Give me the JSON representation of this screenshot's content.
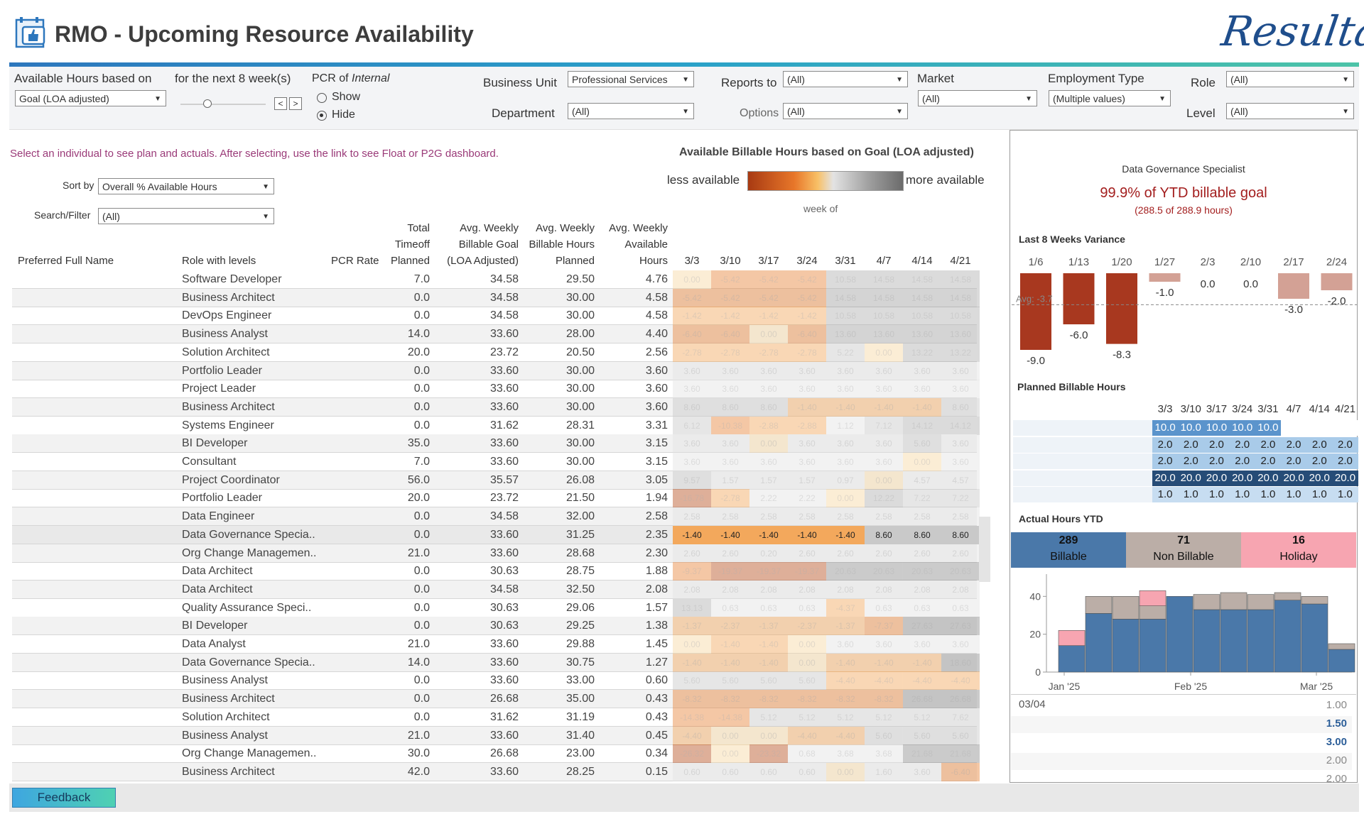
{
  "header": {
    "title": "RMO - Upcoming Resource Availability",
    "logo_text": "Resultant"
  },
  "filters": {
    "available_hours_label": "Available Hours based on",
    "available_hours_value": "Goal (LOA adjusted)",
    "next_weeks_label": "for the next 8 week(s)",
    "pcr_label": "PCR of",
    "pcr_label_italic": "Internal",
    "pcr_show": "Show",
    "pcr_hide": "Hide",
    "pcr_selected": "Hide",
    "business_unit_label": "Business Unit",
    "business_unit_value": "Professional Services",
    "department_label": "Department",
    "department_value": "(All)",
    "reports_to_label": "Reports to",
    "reports_to_value": "(All)",
    "options_label": "Options",
    "options_value": "(All)",
    "market_label": "Market",
    "market_value": "(All)",
    "employment_type_label": "Employment Type",
    "employment_type_value": "(Multiple values)",
    "role_label": "Role",
    "role_value": "(All)",
    "level_label": "Level",
    "level_value": "(All)"
  },
  "main": {
    "instruction": "Select an individual to see plan and actuals.  After selecting, use the link to see Float or P2G dashboard.",
    "sort_by_label": "Sort by",
    "sort_by_value": "Overall % Available Hours",
    "search_label": "Search/Filter",
    "search_value": "(All)",
    "legend_title": "Available Billable Hours based on Goal (LOA adjusted)",
    "legend_less": "less available",
    "legend_more": "more available",
    "week_of_label": "week of"
  },
  "table": {
    "columns": {
      "name": "Preferred Full Name",
      "role": "Role with levels",
      "pcr": "PCR Rate",
      "timeoff": [
        "Total",
        "Timeoff",
        "Planned"
      ],
      "goal": [
        "Avg. Weekly",
        "Billable Goal",
        "(LOA Adjusted)"
      ],
      "planned": [
        "Avg. Weekly",
        "Billable Hours",
        "Planned"
      ],
      "available": [
        "Avg. Weekly",
        "Available",
        "Hours"
      ]
    },
    "weeks": [
      "3/3",
      "3/10",
      "3/17",
      "3/24",
      "3/31",
      "4/7",
      "4/14",
      "4/21"
    ],
    "rows": [
      {
        "role": "Software Developer",
        "timeoff": "7.0",
        "goal": "34.58",
        "planned": "29.50",
        "available": "4.76",
        "weeks": [
          "0.00",
          "-5.42",
          "-5.42",
          "-5.42",
          "10.58",
          "14.58",
          "14.58",
          "14.58"
        ]
      },
      {
        "role": "Business Architect",
        "timeoff": "0.0",
        "goal": "34.58",
        "planned": "30.00",
        "available": "4.58",
        "weeks": [
          "-5.42",
          "-5.42",
          "-5.42",
          "-5.42",
          "14.58",
          "14.58",
          "14.58",
          "14.58"
        ]
      },
      {
        "role": "DevOps Engineer",
        "timeoff": "0.0",
        "goal": "34.58",
        "planned": "30.00",
        "available": "4.58",
        "weeks": [
          "-1.42",
          "-1.42",
          "-1.42",
          "-1.42",
          "10.58",
          "10.58",
          "10.58",
          "10.58"
        ]
      },
      {
        "role": "Business Analyst",
        "timeoff": "14.0",
        "goal": "33.60",
        "planned": "28.00",
        "available": "4.40",
        "weeks": [
          "-6.40",
          "-6.40",
          "0.00",
          "-6.40",
          "13.60",
          "13.60",
          "13.60",
          "13.60"
        ]
      },
      {
        "role": "Solution Architect",
        "timeoff": "20.0",
        "goal": "23.72",
        "planned": "20.50",
        "available": "2.56",
        "weeks": [
          "-2.78",
          "-2.78",
          "-2.78",
          "-2.78",
          "5.22",
          "0.00",
          "13.22",
          "13.22"
        ]
      },
      {
        "role": "Portfolio Leader",
        "timeoff": "0.0",
        "goal": "33.60",
        "planned": "30.00",
        "available": "3.60",
        "weeks": [
          "3.60",
          "3.60",
          "3.60",
          "3.60",
          "3.60",
          "3.60",
          "3.60",
          "3.60"
        ]
      },
      {
        "role": "Project Leader",
        "timeoff": "0.0",
        "goal": "33.60",
        "planned": "30.00",
        "available": "3.60",
        "weeks": [
          "3.60",
          "3.60",
          "3.60",
          "3.60",
          "3.60",
          "3.60",
          "3.60",
          "3.60"
        ]
      },
      {
        "role": "Business Architect",
        "timeoff": "0.0",
        "goal": "33.60",
        "planned": "30.00",
        "available": "3.60",
        "weeks": [
          "8.60",
          "8.60",
          "8.60",
          "-1.40",
          "-1.40",
          "-1.40",
          "-1.40",
          "8.60"
        ]
      },
      {
        "role": "Systems Engineer",
        "timeoff": "0.0",
        "goal": "31.62",
        "planned": "28.31",
        "available": "3.31",
        "weeks": [
          "6.12",
          "-10.38",
          "-2.88",
          "-2.88",
          "1.12",
          "7.12",
          "14.12",
          "14.12"
        ]
      },
      {
        "role": "BI Developer",
        "timeoff": "35.0",
        "goal": "33.60",
        "planned": "30.00",
        "available": "3.15",
        "weeks": [
          "3.60",
          "3.60",
          "0.00",
          "3.60",
          "3.60",
          "3.60",
          "5.60",
          "3.60"
        ]
      },
      {
        "role": "Consultant",
        "timeoff": "7.0",
        "goal": "33.60",
        "planned": "30.00",
        "available": "3.15",
        "weeks": [
          "3.60",
          "3.60",
          "3.60",
          "3.60",
          "3.60",
          "3.60",
          "0.00",
          "3.60"
        ]
      },
      {
        "role": "Project Coordinator",
        "timeoff": "56.0",
        "goal": "35.57",
        "planned": "26.08",
        "available": "3.05",
        "weeks": [
          "9.57",
          "1.57",
          "1.57",
          "1.57",
          "0.97",
          "0.00",
          "4.57",
          "4.57"
        ]
      },
      {
        "role": "Portfolio Leader",
        "timeoff": "20.0",
        "goal": "23.72",
        "planned": "21.50",
        "available": "1.94",
        "weeks": [
          "-16.78",
          "-2.78",
          "2.22",
          "2.22",
          "0.00",
          "12.22",
          "7.22",
          "7.22"
        ]
      },
      {
        "role": "Data Engineer",
        "timeoff": "0.0",
        "goal": "34.58",
        "planned": "32.00",
        "available": "2.58",
        "weeks": [
          "2.58",
          "2.58",
          "2.58",
          "2.58",
          "2.58",
          "2.58",
          "2.58",
          "2.58"
        ]
      },
      {
        "role": "Data Governance Specia..",
        "timeoff": "0.0",
        "goal": "33.60",
        "planned": "31.25",
        "available": "2.35",
        "weeks": [
          "-1.40",
          "-1.40",
          "-1.40",
          "-1.40",
          "-1.40",
          "8.60",
          "8.60",
          "8.60"
        ],
        "selected": true
      },
      {
        "role": "Org Change Managemen..",
        "timeoff": "21.0",
        "goal": "33.60",
        "planned": "28.68",
        "available": "2.30",
        "weeks": [
          "2.60",
          "2.60",
          "0.20",
          "2.60",
          "2.60",
          "2.60",
          "2.60",
          "2.60"
        ]
      },
      {
        "role": "Data Architect",
        "timeoff": "0.0",
        "goal": "30.63",
        "planned": "28.75",
        "available": "1.88",
        "weeks": [
          "-9.37",
          "-19.37",
          "-19.37",
          "-19.37",
          "20.63",
          "20.63",
          "20.63",
          "20.63"
        ]
      },
      {
        "role": "Data Architect",
        "timeoff": "0.0",
        "goal": "34.58",
        "planned": "32.50",
        "available": "2.08",
        "weeks": [
          "2.08",
          "2.08",
          "2.08",
          "2.08",
          "2.08",
          "2.08",
          "2.08",
          "2.08"
        ]
      },
      {
        "role": "Quality Assurance Speci..",
        "timeoff": "0.0",
        "goal": "30.63",
        "planned": "29.06",
        "available": "1.57",
        "weeks": [
          "13.13",
          "0.63",
          "0.63",
          "0.63",
          "-4.37",
          "0.63",
          "0.63",
          "0.63"
        ]
      },
      {
        "role": "BI Developer",
        "timeoff": "0.0",
        "goal": "30.63",
        "planned": "29.25",
        "available": "1.38",
        "weeks": [
          "-1.37",
          "-2.37",
          "-1.37",
          "-2.37",
          "-1.37",
          "-7.37",
          "27.63",
          "27.63"
        ]
      },
      {
        "role": "Data Analyst",
        "timeoff": "21.0",
        "goal": "33.60",
        "planned": "29.88",
        "available": "1.45",
        "weeks": [
          "0.00",
          "-1.40",
          "-1.40",
          "0.00",
          "3.60",
          "3.60",
          "3.60",
          "3.60"
        ]
      },
      {
        "role": "Data Governance Specia..",
        "timeoff": "14.0",
        "goal": "33.60",
        "planned": "30.75",
        "available": "1.27",
        "weeks": [
          "-1.40",
          "-1.40",
          "-1.40",
          "0.00",
          "-1.40",
          "-1.40",
          "-1.40",
          "18.60"
        ]
      },
      {
        "role": "Business Analyst",
        "timeoff": "0.0",
        "goal": "33.60",
        "planned": "33.00",
        "available": "0.60",
        "weeks": [
          "5.60",
          "5.60",
          "5.60",
          "5.60",
          "-4.40",
          "-4.40",
          "-4.40",
          "-4.40"
        ]
      },
      {
        "role": "Business Architect",
        "timeoff": "0.0",
        "goal": "26.68",
        "planned": "35.00",
        "available": "0.43",
        "weeks": [
          "-8.32",
          "-8.32",
          "-8.32",
          "-8.32",
          "-8.32",
          "-8.32",
          "26.68",
          "26.68"
        ]
      },
      {
        "role": "Solution Architect",
        "timeoff": "0.0",
        "goal": "31.62",
        "planned": "31.19",
        "available": "0.43",
        "weeks": [
          "-14.38",
          "-14.38",
          "5.12",
          "5.12",
          "5.12",
          "5.12",
          "5.12",
          "7.62"
        ]
      },
      {
        "role": "Business Analyst",
        "timeoff": "21.0",
        "goal": "33.60",
        "planned": "31.40",
        "available": "0.45",
        "weeks": [
          "-4.40",
          "0.00",
          "0.00",
          "-4.40",
          "-4.40",
          "5.60",
          "5.60",
          "5.60"
        ]
      },
      {
        "role": "Org Change Managemen..",
        "timeoff": "30.0",
        "goal": "26.68",
        "planned": "23.00",
        "available": "0.34",
        "weeks": [
          "-26.32",
          "0.00",
          "-23.32",
          "0.68",
          "3.68",
          "3.68",
          "21.68",
          "21.68"
        ]
      },
      {
        "role": "Business Architect",
        "timeoff": "42.0",
        "goal": "33.60",
        "planned": "28.25",
        "available": "0.15",
        "weeks": [
          "0.60",
          "0.60",
          "0.60",
          "0.60",
          "0.00",
          "1.60",
          "3.60",
          "-6.40"
        ]
      }
    ]
  },
  "panel": {
    "person_title": "Data Governance Specialist",
    "ytd_goal": "99.9% of YTD billable goal",
    "ytd_hours": "(288.5 of 288.9 hours)",
    "variance_title": "Last 8 Weeks Variance",
    "variance_avg_label": "Avg: -3.7",
    "variance_weeks": [
      "1/6",
      "1/13",
      "1/20",
      "1/27",
      "2/3",
      "2/10",
      "2/17",
      "2/24"
    ],
    "variance_values": [
      -9.0,
      -6.0,
      -8.3,
      -1.0,
      0.0,
      0.0,
      -3.0,
      -2.0
    ],
    "variance_labels": [
      "-9.0",
      "-6.0",
      "-8.3",
      "-1.0",
      "0.0",
      "0.0",
      "-3.0",
      "-2.0"
    ],
    "planned_title": "Planned Billable Hours",
    "planned_weeks": [
      "3/3",
      "3/10",
      "3/17",
      "3/24",
      "3/31",
      "4/7",
      "4/14",
      "4/21"
    ],
    "planned_rows": [
      [
        "10.0",
        "10.0",
        "10.0",
        "10.0",
        "10.0",
        "",
        "",
        ""
      ],
      [
        "2.0",
        "2.0",
        "2.0",
        "2.0",
        "2.0",
        "2.0",
        "2.0",
        "2.0"
      ],
      [
        "2.0",
        "2.0",
        "2.0",
        "2.0",
        "2.0",
        "2.0",
        "2.0",
        "2.0"
      ],
      [
        "20.0",
        "20.0",
        "20.0",
        "20.0",
        "20.0",
        "20.0",
        "20.0",
        "20.0"
      ],
      [
        "1.0",
        "1.0",
        "1.0",
        "1.0",
        "1.0",
        "1.0",
        "1.0",
        "1.0"
      ]
    ],
    "actual_title": "Actual Hours YTD",
    "actual_billable_value": "289",
    "actual_billable_label": "Billable",
    "actual_nonbillable_value": "71",
    "actual_nonbillable_label": "Non Billable",
    "actual_holiday_value": "16",
    "actual_holiday_label": "Holiday",
    "bar_axis_ticks": [
      "40",
      "20",
      "0"
    ],
    "bar_axis_months": [
      "Jan '25",
      "Feb '25",
      "Mar '25"
    ],
    "bars": [
      {
        "billable": 14,
        "nonbillable": 0,
        "holiday": 8
      },
      {
        "billable": 31,
        "nonbillable": 9,
        "holiday": 0
      },
      {
        "billable": 28,
        "nonbillable": 12,
        "holiday": 0
      },
      {
        "billable": 28,
        "nonbillable": 7,
        "holiday": 8
      },
      {
        "billable": 40,
        "nonbillable": 0,
        "holiday": 0
      },
      {
        "billable": 33,
        "nonbillable": 8,
        "holiday": 0
      },
      {
        "billable": 33,
        "nonbillable": 9,
        "holiday": 0
      },
      {
        "billable": 33,
        "nonbillable": 8,
        "holiday": 0
      },
      {
        "billable": 38,
        "nonbillable": 4,
        "holiday": 0
      },
      {
        "billable": 36,
        "nonbillable": 4,
        "holiday": 0
      },
      {
        "billable": 12,
        "nonbillable": 3,
        "holiday": 0
      }
    ],
    "detail_date": "03/04",
    "detail_values": [
      "1.00",
      "1.50",
      "3.00",
      "2.00",
      "2.00"
    ]
  },
  "footer": {
    "feedback_label": "Feedback"
  },
  "colors": {
    "billable": "#4a78a9",
    "nonbillable": "#bbaea7",
    "holiday": "#f7a5b1",
    "variance_dark": "#a8381f",
    "variance_light": "#d3a195",
    "title_red": "#a31e1e",
    "accent": "#2d77bd"
  }
}
